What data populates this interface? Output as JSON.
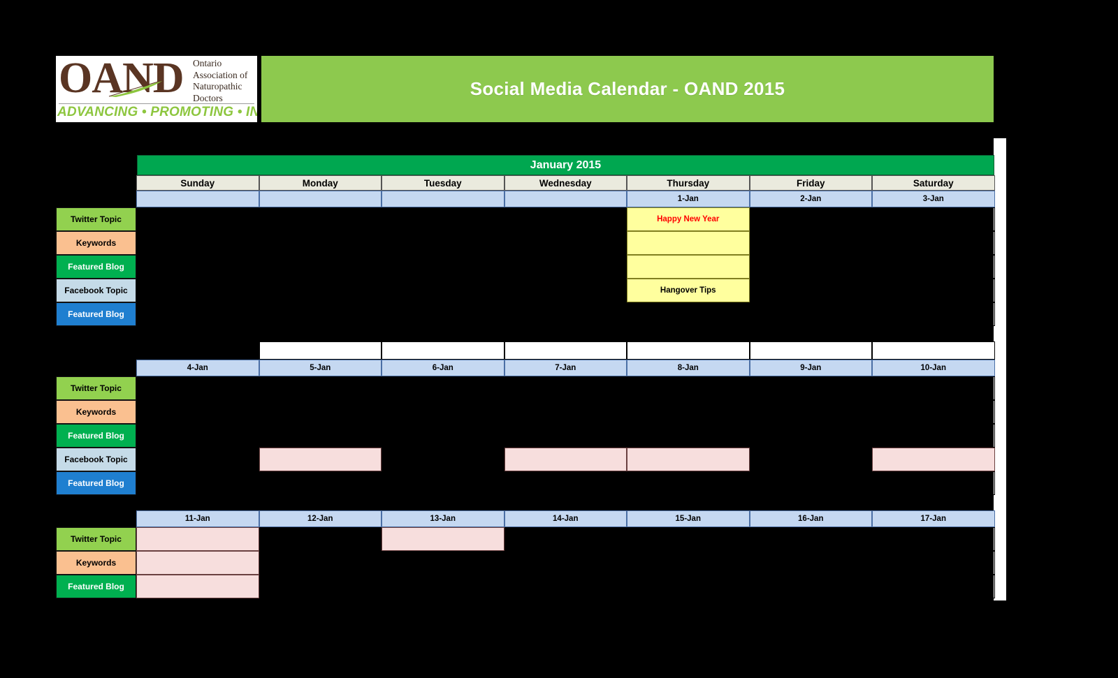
{
  "logo": {
    "main_text": "OAND",
    "sub_line_1": "Ontario",
    "sub_line_2": "Association of",
    "sub_line_3": "Naturopathic",
    "sub_line_4": "Doctors",
    "tagline": "ADVANCING • PROMOTING • INSPIRING"
  },
  "header": {
    "title": "Social Media Calendar - OAND 2015"
  },
  "calendar": {
    "month_label": "January 2015",
    "day_headers": [
      "Sunday",
      "Monday",
      "Tuesday",
      "Wednesday",
      "Thursday",
      "Friday",
      "Saturday"
    ],
    "row_labels": [
      {
        "label": "Twitter Topic",
        "color": "#92d14f",
        "text_color": "#000000"
      },
      {
        "label": "Keywords",
        "color": "#fac090",
        "text_color": "#000000"
      },
      {
        "label": "Featured Blog",
        "color": "#00b050",
        "text_color": "#ffffff"
      },
      {
        "label": "Facebook Topic",
        "color": "#c5dbe8",
        "text_color": "#000000"
      },
      {
        "label": "Featured Blog",
        "color": "#1f7fd0",
        "text_color": "#ffffff"
      }
    ],
    "weeks": [
      {
        "dates": [
          "",
          "",
          "",
          "",
          "1-Jan",
          "2-Jan",
          "3-Jan"
        ],
        "rows": [
          {
            "label": "Twitter Topic",
            "cells": [
              "",
              "",
              "",
              "",
              "Happy New Year",
              "",
              ""
            ],
            "styles": [
              "empty",
              "empty",
              "empty",
              "empty",
              "yellow-red",
              "empty",
              "empty"
            ]
          },
          {
            "label": "Keywords",
            "cells": [
              "",
              "",
              "",
              "",
              "",
              "",
              ""
            ],
            "styles": [
              "empty",
              "empty",
              "empty",
              "empty",
              "yellow",
              "empty",
              "empty"
            ]
          },
          {
            "label": "Featured Blog",
            "cells": [
              "",
              "",
              "",
              "",
              "",
              "",
              ""
            ],
            "styles": [
              "empty",
              "empty",
              "empty",
              "empty",
              "yellow",
              "empty",
              "empty"
            ]
          },
          {
            "label": "Facebook Topic",
            "cells": [
              "",
              "",
              "",
              "",
              "Hangover Tips",
              "",
              ""
            ],
            "styles": [
              "empty",
              "empty",
              "empty",
              "empty",
              "yellow-black",
              "empty",
              "empty"
            ]
          },
          {
            "label": "Featured Blog",
            "cells": [
              "",
              "",
              "",
              "",
              "",
              "",
              ""
            ],
            "styles": [
              "empty",
              "empty",
              "empty",
              "empty",
              "empty",
              "empty",
              "empty"
            ]
          }
        ]
      },
      {
        "spacer": [
          "transparent",
          "white",
          "white",
          "white",
          "white",
          "white",
          "white"
        ],
        "dates": [
          "4-Jan",
          "5-Jan",
          "6-Jan",
          "7-Jan",
          "8-Jan",
          "9-Jan",
          "10-Jan"
        ],
        "rows": [
          {
            "label": "Twitter Topic",
            "cells": [
              "",
              "",
              "",
              "",
              "",
              "",
              ""
            ],
            "styles": [
              "empty",
              "empty",
              "empty",
              "empty",
              "empty",
              "empty",
              "empty"
            ]
          },
          {
            "label": "Keywords",
            "cells": [
              "",
              "",
              "",
              "",
              "",
              "",
              ""
            ],
            "styles": [
              "empty",
              "empty",
              "empty",
              "empty",
              "empty",
              "empty",
              "empty"
            ]
          },
          {
            "label": "Featured Blog",
            "cells": [
              "",
              "",
              "",
              "",
              "",
              "",
              ""
            ],
            "styles": [
              "empty",
              "empty",
              "empty",
              "empty",
              "empty",
              "empty",
              "empty"
            ]
          },
          {
            "label": "Facebook Topic",
            "cells": [
              "",
              "",
              "",
              "",
              "",
              "",
              ""
            ],
            "styles": [
              "empty",
              "pink",
              "empty",
              "pink",
              "pink",
              "empty",
              "pink"
            ]
          },
          {
            "label": "Featured Blog",
            "cells": [
              "",
              "",
              "",
              "",
              "",
              "",
              ""
            ],
            "styles": [
              "empty",
              "empty",
              "empty",
              "empty",
              "empty",
              "empty",
              "empty"
            ]
          }
        ]
      },
      {
        "dates": [
          "11-Jan",
          "12-Jan",
          "13-Jan",
          "14-Jan",
          "15-Jan",
          "16-Jan",
          "17-Jan"
        ],
        "rows": [
          {
            "label": "Twitter Topic",
            "cells": [
              "",
              "",
              "",
              "",
              "",
              "",
              ""
            ],
            "styles": [
              "pink",
              "empty",
              "pink",
              "empty",
              "empty",
              "empty",
              "empty"
            ]
          },
          {
            "label": "Keywords",
            "cells": [
              "",
              "",
              "",
              "",
              "",
              "",
              ""
            ],
            "styles": [
              "pink",
              "empty",
              "empty",
              "empty",
              "empty",
              "empty",
              "empty"
            ]
          },
          {
            "label": "Featured Blog",
            "cells": [
              "",
              "",
              "",
              "",
              "",
              "",
              ""
            ],
            "styles": [
              "pink",
              "empty",
              "empty",
              "empty",
              "empty",
              "empty",
              "empty"
            ]
          }
        ]
      }
    ]
  }
}
